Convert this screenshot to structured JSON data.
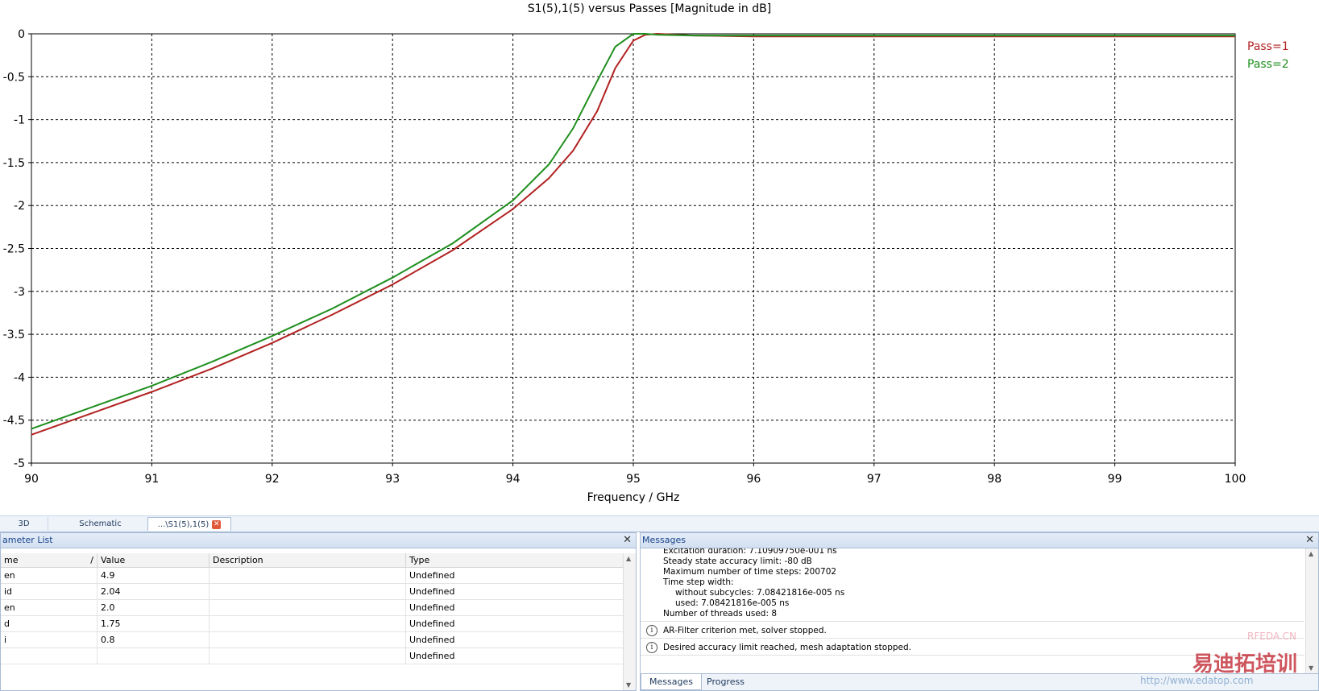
{
  "chart_data": {
    "type": "line",
    "title": "S1(5),1(5) versus Passes [Magnitude in dB]",
    "xlabel": "Frequency / GHz",
    "ylabel": "",
    "xlim": [
      90,
      100
    ],
    "ylim": [
      -5,
      0
    ],
    "x_ticks": [
      90,
      91,
      92,
      93,
      94,
      95,
      96,
      97,
      98,
      99,
      100
    ],
    "y_ticks": [
      0,
      -0.5,
      -1,
      -1.5,
      -2,
      -2.5,
      -3,
      -3.5,
      -4,
      -4.5,
      -5
    ],
    "grid": true,
    "legend_position": "right",
    "series": [
      {
        "name": "Pass=1",
        "color": "#b22222",
        "x": [
          90,
          90.5,
          91,
          91.5,
          92,
          92.5,
          93,
          93.5,
          94,
          94.3,
          94.5,
          94.7,
          94.85,
          95,
          95.1,
          95.2,
          95.5,
          96,
          97,
          98,
          99,
          100
        ],
        "y": [
          -4.67,
          -4.42,
          -4.17,
          -3.9,
          -3.6,
          -3.27,
          -2.92,
          -2.52,
          -2.04,
          -1.68,
          -1.36,
          -0.9,
          -0.4,
          -0.08,
          -0.01,
          0,
          -0.02,
          -0.03,
          -0.03,
          -0.03,
          -0.03,
          -0.03
        ]
      },
      {
        "name": "Pass=2",
        "color": "#1f8f1f",
        "x": [
          90,
          90.5,
          91,
          91.5,
          92,
          92.5,
          93,
          93.5,
          94,
          94.3,
          94.5,
          94.7,
          94.85,
          95,
          95.1,
          95.2,
          95.5,
          96,
          97,
          98,
          99,
          100
        ],
        "y": [
          -4.6,
          -4.35,
          -4.1,
          -3.82,
          -3.52,
          -3.2,
          -2.84,
          -2.44,
          -1.94,
          -1.52,
          -1.1,
          -0.55,
          -0.15,
          0,
          0,
          -0.01,
          -0.02,
          -0.02,
          -0.02,
          -0.02,
          -0.02,
          -0.02
        ]
      }
    ]
  },
  "tabs": [
    {
      "label": "3D"
    },
    {
      "label": "Schematic"
    },
    {
      "label": "...\\S1(5),1(5)"
    }
  ],
  "param_panel": {
    "title": "ameter List",
    "columns": [
      "me",
      "/",
      "Value",
      "Description",
      "Type"
    ],
    "rows": [
      {
        "name": "en",
        "value": "4.9",
        "description": "",
        "type": "Undefined"
      },
      {
        "name": "id",
        "value": "2.04",
        "description": "",
        "type": "Undefined"
      },
      {
        "name": "en",
        "value": "2.0",
        "description": "",
        "type": "Undefined"
      },
      {
        "name": "d",
        "value": "1.75",
        "description": "",
        "type": "Undefined"
      },
      {
        "name": "i",
        "value": "0.8",
        "description": "",
        "type": "Undefined"
      },
      {
        "name": "",
        "value": "",
        "description": "",
        "type": "Undefined"
      }
    ]
  },
  "messages_panel": {
    "title": "Messages",
    "lines": [
      {
        "text": "Excitation duration: 7.10909750e-001 ns",
        "indent": false
      },
      {
        "text": "Steady state accuracy limit: -80 dB",
        "indent": false
      },
      {
        "text": "Maximum number of time steps: 200702",
        "indent": false
      },
      {
        "text": "Time step width:",
        "indent": false
      },
      {
        "text": "without subcycles: 7.08421816e-005 ns",
        "indent": true
      },
      {
        "text": "used: 7.08421816e-005 ns",
        "indent": true
      },
      {
        "text": "Number of threads used: 8",
        "indent": false
      }
    ],
    "info_messages": [
      "AR-Filter criterion met, solver stopped.",
      "Desired accuracy limit reached, mesh adaptation stopped."
    ],
    "tabs": [
      "Messages",
      "Progress"
    ]
  },
  "watermark": {
    "brand": "RFEDA.CN",
    "cn_text": "易迪拓培训",
    "url": "http://www.edatop.com"
  }
}
